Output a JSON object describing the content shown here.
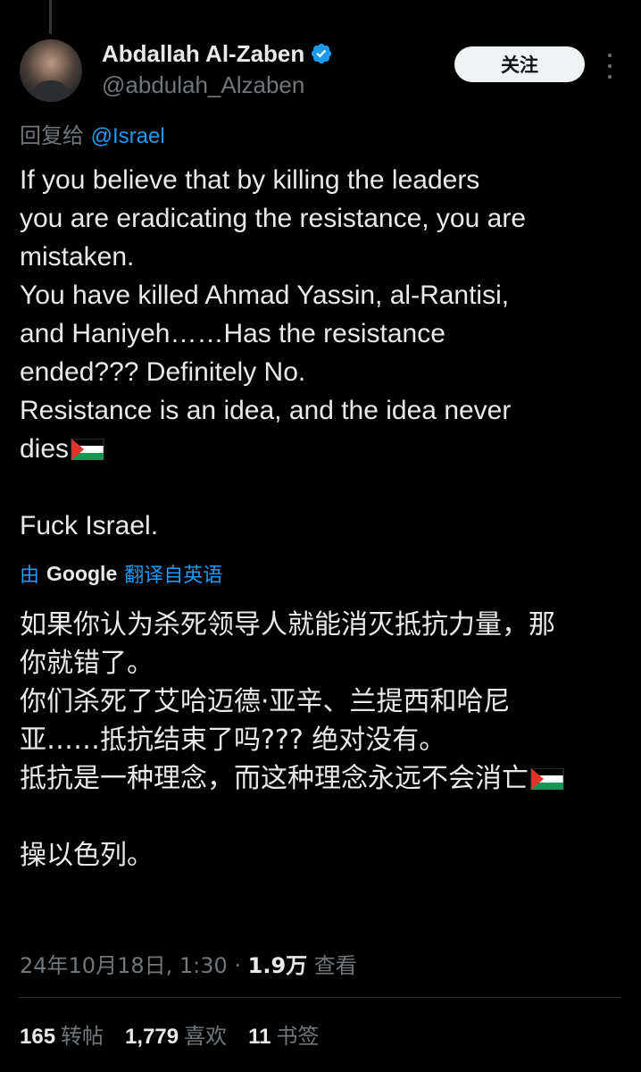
{
  "author": {
    "display_name": "Abdallah Al-Zaben",
    "handle": "@abdulah_Alzaben",
    "verified_icon": "verified-badge-icon"
  },
  "actions": {
    "follow_label": "关注",
    "more_icon": "more-dots-icon"
  },
  "reply": {
    "prefix": "回复给",
    "mention": "@Israel"
  },
  "tweet": {
    "lines": [
      "If you believe that by killing the leaders",
      "you are eradicating the resistance, you are",
      "mistaken.",
      "You have killed Ahmad Yassin, al-Rantisi,",
      "and Haniyeh……Has the resistance",
      "ended??? Definitely No.",
      "Resistance is an idea, and the idea never",
      "dies",
      "",
      "Fuck Israel."
    ]
  },
  "translation": {
    "by": "由",
    "google": "Google",
    "from": "翻译自英语",
    "lines": [
      "如果你认为杀死领导人就能消灭抵抗力量，那",
      "你就错了。",
      "你们杀死了艾哈迈德·亚辛、兰提西和哈尼",
      "亚……抵抗结束了吗???  绝对没有。",
      "抵抗是一种理念，而这种理念永远不会消亡",
      "",
      "操以色列。"
    ]
  },
  "meta": {
    "timestamp": "24年10月18日, 1:30 · ",
    "views_count": "1.9万",
    "views_label": " 查看"
  },
  "stats": {
    "reposts_count": "165",
    "reposts_label": "转帖",
    "likes_count": "1,779",
    "likes_label": "喜欢",
    "bookmarks_count": "11",
    "bookmarks_label": "书签"
  },
  "colors": {
    "background": "#000000",
    "text": "#e7e9ea",
    "secondary": "#71767b",
    "accent": "#1d9bf0",
    "flag_red": "#e4312b",
    "flag_green": "#149954"
  }
}
